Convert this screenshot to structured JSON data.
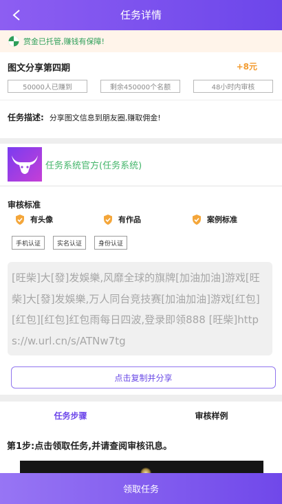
{
  "header": {
    "title": "任务详情",
    "back_icon": "chevron-left-icon"
  },
  "notice": {
    "text": "赏金已托管,赚钱有保障!",
    "icon": "shield-check-icon",
    "color": "#2f9f5a"
  },
  "task": {
    "name": "图文分享第四期",
    "reward": "+8元",
    "tags": [
      "50000人已赚到",
      "剩余450000个名额",
      "48小时内审核"
    ],
    "description_label": "任务描述:",
    "description": "分享图文信息到朋友圈,赚取佣金!"
  },
  "publisher": {
    "name": "任务系统官方(任务系统)",
    "avatar_icon": "bull-logo-icon"
  },
  "review": {
    "title": "审核标准",
    "standards": [
      "有头像",
      "有作品",
      "案例标准"
    ],
    "certifications": [
      "手机认证",
      "实名认证",
      "身份认证"
    ],
    "copy_text": "[旺柴]大[發]发娛樂,风靡全球的旗牌[加油加油]游戏[旺柴]大[發]发娛樂,万人同台竞技赛[加油加油]游戏[红包][红包][红包]红包雨每日四波,登录即领888 [旺柴]https://w.url.cn/s/ATNw7tg",
    "copy_button": "点击复制并分享"
  },
  "tabs": [
    {
      "label": "任务步骤",
      "active": true
    },
    {
      "label": "审核样例",
      "active": false
    }
  ],
  "steps": {
    "step1": "第1步:点击领取任务,并请查阅审核讯息。"
  },
  "footer": {
    "claim_button": "领取任务"
  },
  "colors": {
    "accent": "#6c46ea",
    "reward": "#f29b30",
    "publisher": "#43b56a",
    "badge": "#f4a63a"
  }
}
